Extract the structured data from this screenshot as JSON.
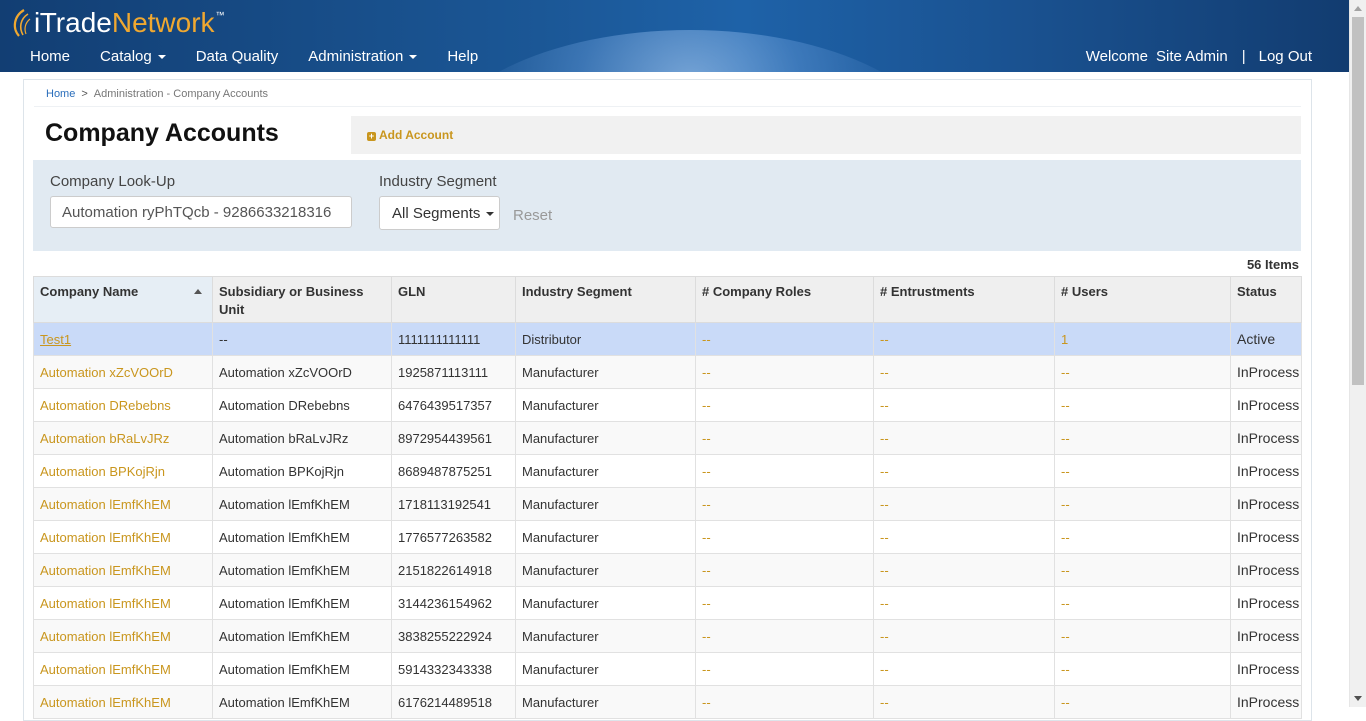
{
  "app": {
    "logo_i": "i",
    "logo_trade": "Trade",
    "logo_network": "Network",
    "logo_tm": "™"
  },
  "nav": {
    "home": "Home",
    "catalog": "Catalog",
    "data_quality": "Data Quality",
    "administration": "Administration",
    "help": "Help"
  },
  "user": {
    "welcome": "Welcome",
    "name": "Site Admin",
    "separator": "|",
    "logout": "Log Out"
  },
  "breadcrumb": {
    "home": "Home",
    "separator": ">",
    "current": "Administration - Company Accounts"
  },
  "page": {
    "title": "Company Accounts",
    "add_account": "Add Account"
  },
  "filters": {
    "lookup_label": "Company Look-Up",
    "lookup_value": "Automation ryPhTQcb - 9286633218316",
    "segment_label": "Industry Segment",
    "segment_value": "All Segments",
    "reset": "Reset"
  },
  "table": {
    "count": "56 Items",
    "columns": [
      "Company Name",
      "Subsidiary or Business Unit",
      "GLN",
      "Industry Segment",
      "# Company Roles",
      "# Entrustments",
      "# Users",
      "Status"
    ],
    "rows": [
      [
        "Test1",
        "--",
        "1111111111111",
        "Distributor",
        "--",
        "--",
        "1",
        "Active"
      ],
      [
        "Automation xZcVOOrD",
        "Automation xZcVOOrD",
        "1925871113111",
        "Manufacturer",
        "--",
        "--",
        "--",
        "InProcess"
      ],
      [
        "Automation DRebebns",
        "Automation DRebebns",
        "6476439517357",
        "Manufacturer",
        "--",
        "--",
        "--",
        "InProcess"
      ],
      [
        "Automation bRaLvJRz",
        "Automation bRaLvJRz",
        "8972954439561",
        "Manufacturer",
        "--",
        "--",
        "--",
        "InProcess"
      ],
      [
        "Automation BPKojRjn",
        "Automation BPKojRjn",
        "8689487875251",
        "Manufacturer",
        "--",
        "--",
        "--",
        "InProcess"
      ],
      [
        "Automation lEmfKhEM",
        "Automation lEmfKhEM",
        "1718113192541",
        "Manufacturer",
        "--",
        "--",
        "--",
        "InProcess"
      ],
      [
        "Automation lEmfKhEM",
        "Automation lEmfKhEM",
        "1776577263582",
        "Manufacturer",
        "--",
        "--",
        "--",
        "InProcess"
      ],
      [
        "Automation lEmfKhEM",
        "Automation lEmfKhEM",
        "2151822614918",
        "Manufacturer",
        "--",
        "--",
        "--",
        "InProcess"
      ],
      [
        "Automation lEmfKhEM",
        "Automation lEmfKhEM",
        "3144236154962",
        "Manufacturer",
        "--",
        "--",
        "--",
        "InProcess"
      ],
      [
        "Automation lEmfKhEM",
        "Automation lEmfKhEM",
        "3838255222924",
        "Manufacturer",
        "--",
        "--",
        "--",
        "InProcess"
      ],
      [
        "Automation lEmfKhEM",
        "Automation lEmfKhEM",
        "5914332343338",
        "Manufacturer",
        "--",
        "--",
        "--",
        "InProcess"
      ],
      [
        "Automation lEmfKhEM",
        "Automation lEmfKhEM",
        "6176214489518",
        "Manufacturer",
        "--",
        "--",
        "--",
        "InProcess"
      ]
    ]
  },
  "colors": {
    "header_blue": "#1b5796",
    "accent_gold": "#c9961e",
    "selected_row": "#c9daf8",
    "filter_bg": "#e1eaf2"
  },
  "icons": {
    "logo": "swirl-logo-icon",
    "add": "plus-square-icon",
    "sort": "sort-ascending-icon",
    "dropdown": "caret-down-icon"
  }
}
